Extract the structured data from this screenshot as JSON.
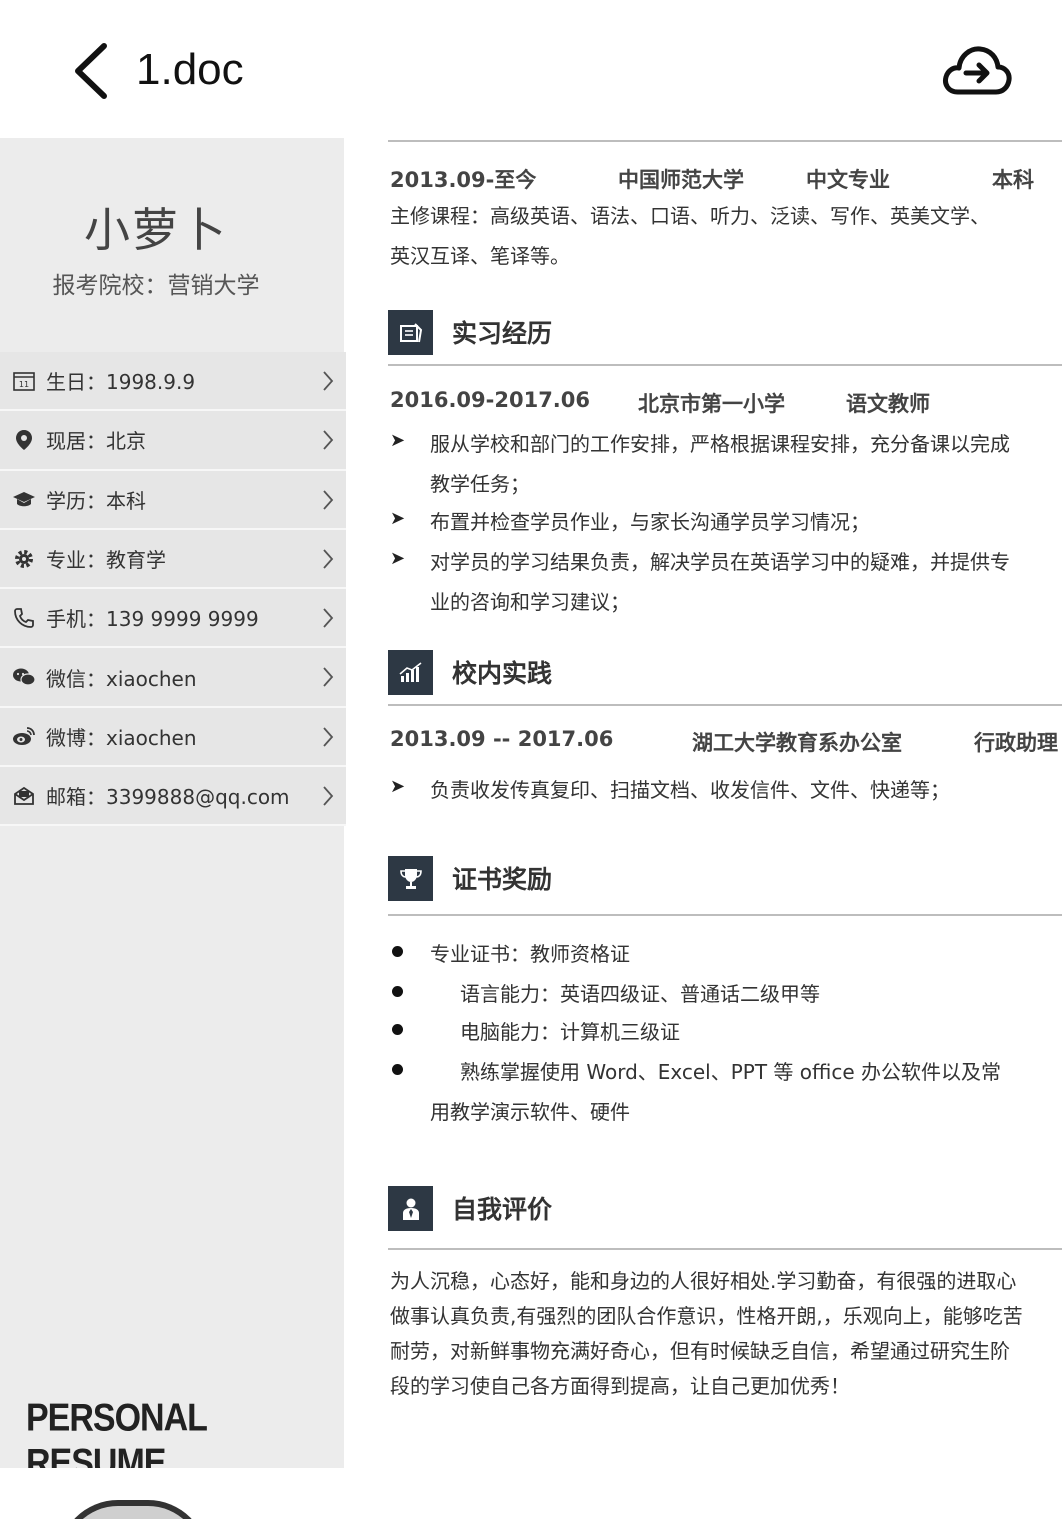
{
  "header": {
    "title": "1.doc"
  },
  "profile": {
    "name": "小萝卜",
    "school": "报考院校：营销大学",
    "items": [
      {
        "icon": "calendar-icon",
        "label": "生日：1998.9.9"
      },
      {
        "icon": "location-pin-icon",
        "label": "现居：北京"
      },
      {
        "icon": "graduation-cap-icon",
        "label": "学历：本科"
      },
      {
        "icon": "gear-icon",
        "label": "专业：教育学"
      },
      {
        "icon": "phone-icon",
        "label": "手机：139 9999 9999"
      },
      {
        "icon": "wechat-icon",
        "label": "微信：xiaochen"
      },
      {
        "icon": "weibo-icon",
        "label": "微博：xiaochen"
      },
      {
        "icon": "mail-icon",
        "label": "邮箱：3399888@qq.com"
      }
    ],
    "footer": "PERSONAL RESUME"
  },
  "education": {
    "date": "2013.09-至今",
    "school": "中国师范大学",
    "major": "中文专业",
    "degree": "本科",
    "lines": [
      "主修课程：高级英语、语法、口语、听力、泛读、写作、英美文学、",
      "英汉互译、笔译等。"
    ]
  },
  "internship": {
    "title": "实习经历",
    "date": "2016.09-2017.06",
    "org": "北京市第一小学",
    "role": "语文教师",
    "bullets": [
      [
        "服从学校和部门的工作安排，严格根据课程安排，充分备课以完成",
        "教学任务；"
      ],
      [
        "布置并检查学员作业，与家长沟通学员学习情况；"
      ],
      [
        "对学员的学习结果负责，解决学员在英语学习中的疑难，并提供专",
        "业的咨询和学习建议；"
      ]
    ]
  },
  "practice": {
    "title": "校内实践",
    "date": "2013.09 -- 2017.06",
    "org": "湖工大学教育系办公室",
    "role": "行政助理",
    "bullets": [
      "负责收发传真复印、扫描文档、收发信件、文件、快递等；"
    ]
  },
  "awards": {
    "title": "证书奖励",
    "items": [
      "专业证书：教师资格证",
      "语言能力：英语四级证、普通话二级甲等",
      "电脑能力：计算机三级证",
      "熟练掌握使用 Word、Excel、PPT 等 office 办公软件以及常",
      "用教学演示软件、硬件"
    ]
  },
  "self": {
    "title": "自我评价",
    "lines": [
      "为人沉稳，心态好，能和身边的人很好相处.学习勤奋，有很强的进取心",
      "做事认真负责,有强烈的团队合作意识，性格开朗,，乐观向上，能够吃苦",
      "耐劳，对新鲜事物充满好奇心，但有时候缺乏自信，希望通过研究生阶",
      "段的学习使自己各方面得到提高，让自己更加优秀！"
    ]
  }
}
